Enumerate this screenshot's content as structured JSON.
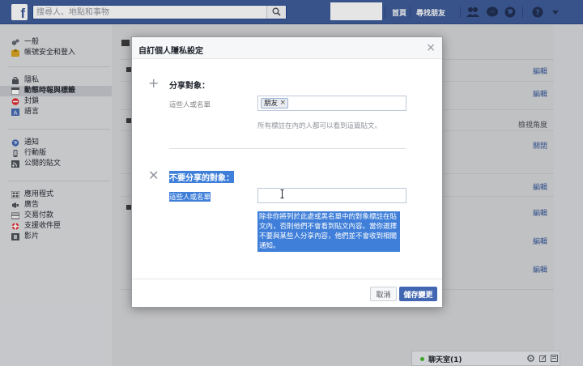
{
  "topbar": {
    "logo": "f",
    "search_placeholder": "搜尋人、地點和事物",
    "nav_home": "首頁",
    "nav_find_friends": "尋找朋友"
  },
  "sidebar": {
    "group1": [
      "一般",
      "帳號安全和登入"
    ],
    "group2": [
      "隱私",
      "動態時報與標籤",
      "封鎖",
      "語言"
    ],
    "group3": [
      "通知",
      "行動版",
      "公開的貼文"
    ],
    "group4": [
      "應用程式",
      "廣告",
      "交易付款",
      "支援收件匣",
      "影片"
    ]
  },
  "main": {
    "edit": "編輯",
    "view_as": "檢視角度",
    "close": "關閉"
  },
  "chat": {
    "label": "聊天室(1)"
  },
  "modal": {
    "title": "自訂個人隱私設定",
    "close": "×",
    "share": {
      "title": "分享對象：",
      "label": "這些人或名單",
      "token": "朋友",
      "hint": "所有標註在內的人都可以看到這篇貼文。"
    },
    "exclude": {
      "title": "不要分享的對象：",
      "label": "這些人或名單",
      "hint": "除非你將列於此處或黑名單中的對象標註在貼文內，否則他們不會看到貼文內容。當你選擇不要與某些人分享內容，他們並不會收到相關通知。"
    },
    "cancel": "取消",
    "save": "儲存變更"
  }
}
